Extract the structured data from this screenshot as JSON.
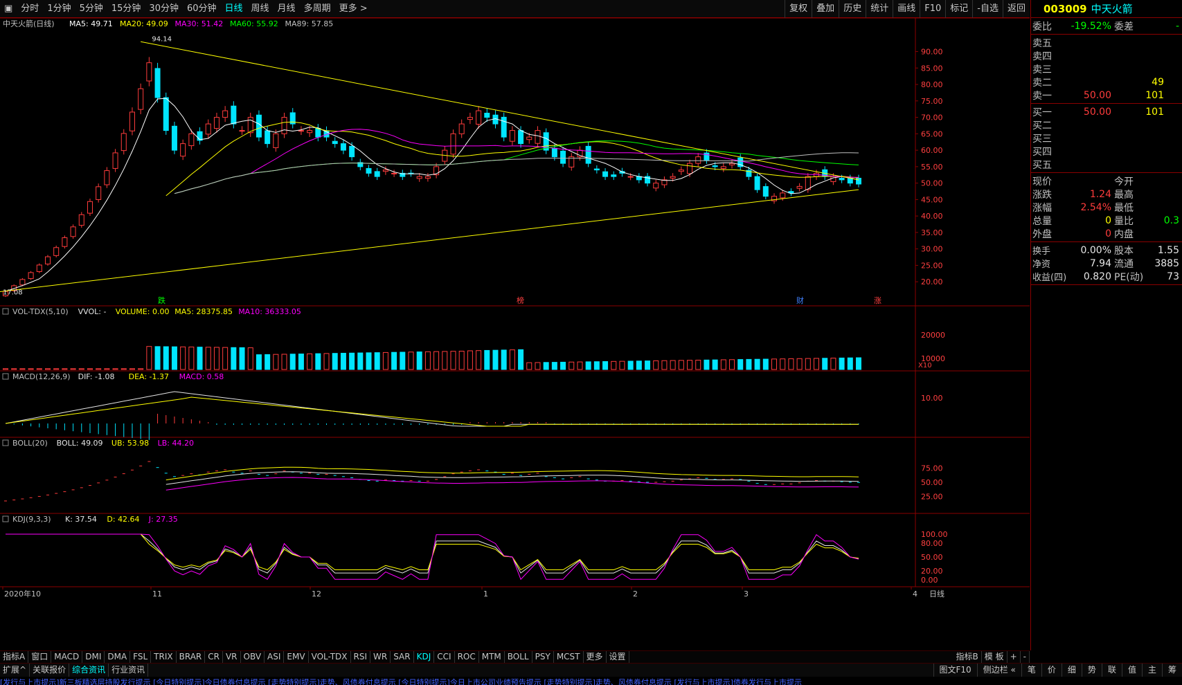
{
  "toolbar": {
    "left": [
      "分时",
      "1分钟",
      "5分钟",
      "15分钟",
      "30分钟",
      "60分钟",
      "日线",
      "周线",
      "月线",
      "多周期",
      "更多 >"
    ],
    "active_index": 6,
    "right": [
      "复权",
      "叠加",
      "历史",
      "统计",
      "画线",
      "F10",
      "标记",
      "-自选",
      "返回"
    ]
  },
  "main": {
    "title": "中天火箭(日线)",
    "ma": [
      {
        "label": "MA5: 49.71",
        "color": "#ffffff"
      },
      {
        "label": "MA20: 49.09",
        "color": "#ffff00"
      },
      {
        "label": "MA30: 51.42",
        "color": "#ff00ff"
      },
      {
        "label": "MA60: 55.92",
        "color": "#00ff00"
      },
      {
        "label": "MA89: 57.85",
        "color": "#c0c0c0"
      }
    ],
    "yticks": [
      "90.00",
      "85.00",
      "80.00",
      "75.00",
      "70.00",
      "65.00",
      "60.00",
      "55.00",
      "50.00",
      "45.00",
      "40.00",
      "35.00",
      "30.00",
      "25.00",
      "20.00"
    ],
    "high_label": "94.14",
    "low_label": "17.08",
    "markers": [
      "跌",
      "榜",
      "财",
      "涨"
    ]
  },
  "vol": {
    "title": "VOL-TDX(5,10)",
    "items": [
      {
        "label": "VVOL: -",
        "color": "#e6e6e6"
      },
      {
        "label": "VOLUME: 0.00",
        "color": "#ffff00"
      },
      {
        "label": "MA5: 28375.85",
        "color": "#ffff00"
      },
      {
        "label": "MA10: 36333.05",
        "color": "#ff00ff"
      }
    ],
    "yticks": [
      "20000",
      "10000"
    ],
    "unit": "X10"
  },
  "macd": {
    "title": "MACD(12,26,9)",
    "items": [
      {
        "label": "DIF: -1.08",
        "color": "#e6e6e6"
      },
      {
        "label": "DEA: -1.37",
        "color": "#ffff00"
      },
      {
        "label": "MACD: 0.58",
        "color": "#ff00ff"
      }
    ],
    "yticks": [
      "10.00"
    ]
  },
  "boll": {
    "title": "BOLL(20)",
    "items": [
      {
        "label": "BOLL: 49.09",
        "color": "#e6e6e6"
      },
      {
        "label": "UB: 53.98",
        "color": "#ffff00"
      },
      {
        "label": "LB: 44.20",
        "color": "#ff00ff"
      }
    ],
    "yticks": [
      "75.00",
      "50.00",
      "25.00"
    ]
  },
  "kdj": {
    "title": "KDJ(9,3,3)",
    "items": [
      {
        "label": "K: 37.54",
        "color": "#e6e6e6"
      },
      {
        "label": "D: 42.64",
        "color": "#ffff00"
      },
      {
        "label": "J: 27.35",
        "color": "#ff00ff"
      }
    ],
    "yticks": [
      "100.00",
      "80.00",
      "50.00",
      "20.00",
      "0.00"
    ]
  },
  "xaxis": {
    "labels": [
      "2020年10",
      "11",
      "12",
      "1",
      "2",
      "3",
      "4"
    ],
    "right": "日线"
  },
  "quote": {
    "code": "003009",
    "name": "中天火箭",
    "weibi_label": "委比",
    "weibi": "-19.52%",
    "weicha_label": "委差",
    "weicha": "-",
    "asks": [
      {
        "label": "卖五",
        "price": "",
        "vol": ""
      },
      {
        "label": "卖四",
        "price": "",
        "vol": ""
      },
      {
        "label": "卖三",
        "price": "",
        "vol": ""
      },
      {
        "label": "卖二",
        "price": "",
        "vol": "49"
      },
      {
        "label": "卖一",
        "price": "50.00",
        "vol": "101"
      }
    ],
    "bids": [
      {
        "label": "买一",
        "price": "50.00",
        "vol": "101"
      },
      {
        "label": "买二",
        "price": "",
        "vol": ""
      },
      {
        "label": "买三",
        "price": "",
        "vol": ""
      },
      {
        "label": "买四",
        "price": "",
        "vol": ""
      },
      {
        "label": "买五",
        "price": "",
        "vol": ""
      }
    ],
    "stats": [
      {
        "l1": "现价",
        "v1": "",
        "l2": "今开",
        "v2": "",
        "c1": "white",
        "c2": "white"
      },
      {
        "l1": "涨跌",
        "v1": "1.24",
        "l2": "最高",
        "v2": "",
        "c1": "red",
        "c2": "red"
      },
      {
        "l1": "涨幅",
        "v1": "2.54%",
        "l2": "最低",
        "v2": "",
        "c1": "red",
        "c2": "red"
      },
      {
        "l1": "总量",
        "v1": "0",
        "l2": "量比",
        "v2": "0.3",
        "c1": "yellow",
        "c2": "green"
      },
      {
        "l1": "外盘",
        "v1": "0",
        "l2": "内盘",
        "v2": "",
        "c1": "red",
        "c2": "green"
      }
    ],
    "stats2": [
      {
        "l1": "换手",
        "v1": "0.00%",
        "l2": "股本",
        "v2": "1.55"
      },
      {
        "l1": "净资",
        "v1": "7.94",
        "l2": "流通",
        "v2": "3885"
      },
      {
        "l1": "收益(四)",
        "v1": "0.820",
        "l2": "PE(动)",
        "v2": "73"
      }
    ]
  },
  "bottom_tabs": [
    "指标A",
    "窗口",
    "MACD",
    "DMI",
    "DMA",
    "FSL",
    "TRIX",
    "BRAR",
    "CR",
    "VR",
    "OBV",
    "ASI",
    "EMV",
    "VOL-TDX",
    "RSI",
    "WR",
    "SAR",
    "KDJ",
    "CCI",
    "ROC",
    "MTM",
    "BOLL",
    "PSY",
    "MCST",
    "更多",
    "设置"
  ],
  "bottom_tabs_active": 17,
  "bottom_right_tabs": [
    "指标B",
    "模 板",
    "+",
    "-"
  ],
  "tabs2": [
    "扩展^",
    "关联报价",
    "综合资讯",
    "行业资讯"
  ],
  "tabs2_right": [
    "图文F10",
    "侧边栏 «",
    "笔",
    "价",
    "细",
    "势",
    "联",
    "值",
    "主",
    "筹"
  ],
  "ticker": "[发行与上市提示]新三板精选层持股发行提示  [今日特别提示]今日债券付息提示  [走势特别提示]走势、风债券付息提示  [今日特别提示]今日上市公司业绩预告提示  [走势特别提示]走势、风债券付息提示  [发行与上市提示]债券发行与上市提示",
  "chart_data": {
    "type": "candlestick",
    "title": "中天火箭(日线)",
    "price_range": [
      15,
      96
    ],
    "closes": [
      17.08,
      18.8,
      20.7,
      22.8,
      25.1,
      27.6,
      30.4,
      33.4,
      36.7,
      40.4,
      44.4,
      48.9,
      53.8,
      59.2,
      65.1,
      71.6,
      78.7,
      86.6,
      76,
      66,
      60,
      62,
      65,
      63,
      68,
      70,
      72,
      68,
      66,
      70,
      64,
      62,
      65,
      70,
      68,
      66,
      66,
      64,
      64,
      62,
      60,
      58,
      55,
      53,
      52,
      54,
      53,
      52,
      53,
      52,
      52,
      55,
      60,
      65,
      68,
      70,
      72,
      70,
      68,
      64,
      66,
      62,
      64,
      66,
      60,
      58,
      56,
      58,
      60,
      56,
      54,
      52,
      52,
      53,
      52,
      51,
      50,
      50,
      51,
      52,
      54,
      56,
      58,
      57,
      55,
      55,
      56,
      55,
      52,
      48,
      46,
      46,
      47,
      47,
      49,
      52,
      53,
      52,
      52,
      51,
      50,
      49.71
    ],
    "ma_last": {
      "MA5": 49.71,
      "MA20": 49.09,
      "MA30": 51.42,
      "MA60": 55.92,
      "MA89": 57.85
    }
  }
}
